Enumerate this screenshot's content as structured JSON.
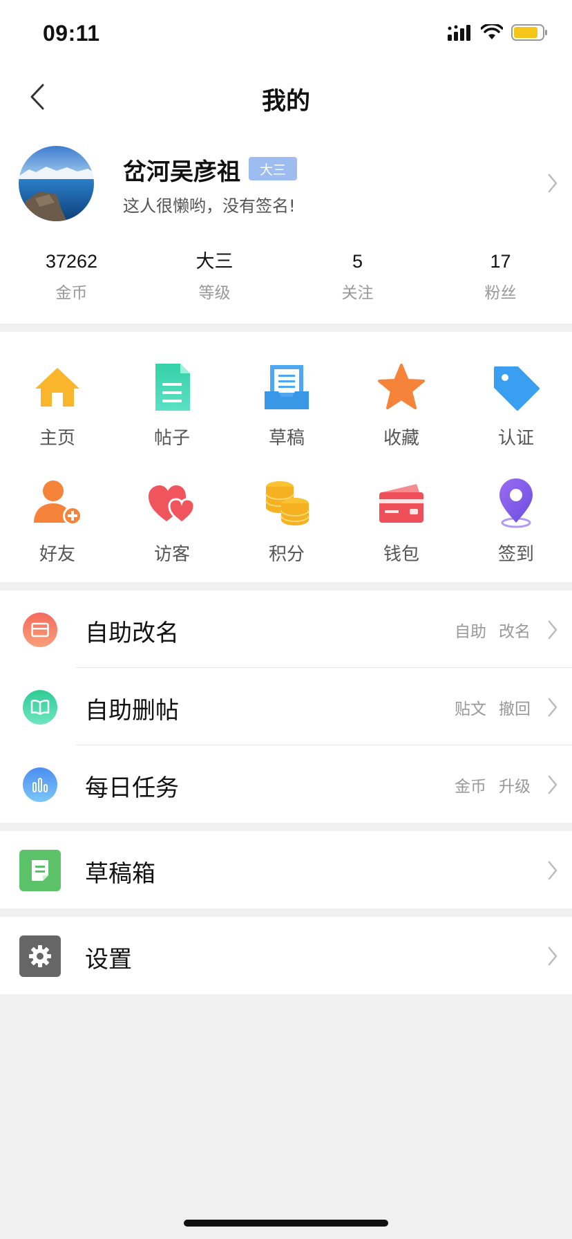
{
  "status_bar": {
    "time": "09:11",
    "battery_color": "#f5c518"
  },
  "nav": {
    "title": "我的",
    "back_icon": "chevron-left-icon"
  },
  "profile": {
    "username": "岔河吴彦祖",
    "level_badge": "大三",
    "signature": "这人很懒哟，没有签名!",
    "badge_color": "#9dbcf0"
  },
  "stats": [
    {
      "value": "37262",
      "label": "金币"
    },
    {
      "value": "大三",
      "label": "等级"
    },
    {
      "value": "5",
      "label": "关注"
    },
    {
      "value": "17",
      "label": "粉丝"
    }
  ],
  "grid": [
    {
      "label": "主页",
      "icon": "home-icon"
    },
    {
      "label": "帖子",
      "icon": "document-icon"
    },
    {
      "label": "草稿",
      "icon": "draft-tray-icon"
    },
    {
      "label": "收藏",
      "icon": "star-icon"
    },
    {
      "label": "认证",
      "icon": "tag-icon"
    },
    {
      "label": "好友",
      "icon": "add-friend-icon"
    },
    {
      "label": "访客",
      "icon": "hearts-icon"
    },
    {
      "label": "积分",
      "icon": "coins-icon"
    },
    {
      "label": "钱包",
      "icon": "wallet-icon"
    },
    {
      "label": "签到",
      "icon": "location-pin-icon"
    }
  ],
  "menu": [
    {
      "title": "自助改名",
      "tags": [
        "自助",
        "改名"
      ],
      "icon": "card-icon",
      "color": "#f07a62"
    },
    {
      "title": "自助删帖",
      "tags": [
        "贴文",
        "撤回"
      ],
      "icon": "book-icon",
      "color": "#3dd0a0"
    },
    {
      "title": "每日任务",
      "tags": [
        "金币",
        "升级"
      ],
      "icon": "bar-chart-icon",
      "color": "#5aa8f5"
    }
  ],
  "drafts": {
    "title": "草稿箱",
    "icon": "note-icon",
    "color": "#5cc26a"
  },
  "settings": {
    "title": "设置",
    "icon": "gear-icon",
    "color": "#666666"
  }
}
